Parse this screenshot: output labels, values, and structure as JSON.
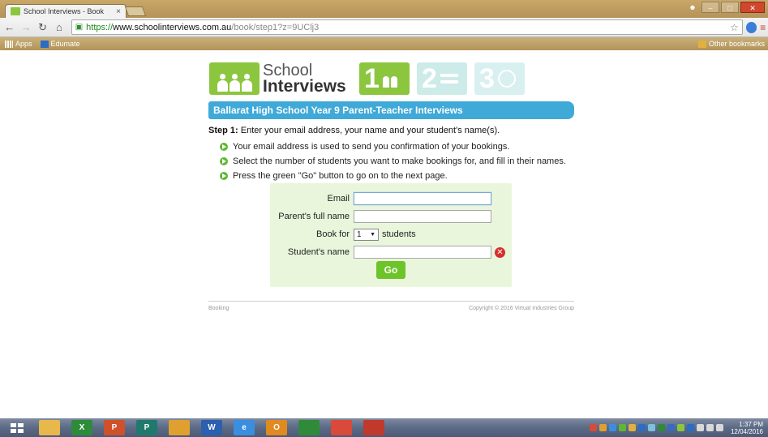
{
  "browser": {
    "tab_title": "School Interviews - Book",
    "tab_close": "×",
    "url_scheme": "https://",
    "url_host": "www.schoolinterviews.com.au",
    "url_path": "/book/step1?z=9UClj3",
    "bookmarks": [
      {
        "label": "Apps"
      },
      {
        "label": "Edumate"
      }
    ],
    "other_bookmarks": "Other bookmarks"
  },
  "logo": {
    "line1": "School",
    "line2": "Interviews"
  },
  "steps": [
    {
      "number": "1",
      "color": "#8cc63f"
    },
    {
      "number": "2",
      "color": "#cdebe8"
    },
    {
      "number": "3",
      "color": "#d9f0f0"
    }
  ],
  "page": {
    "title": "Ballarat High School Year 9 Parent-Teacher Interviews",
    "step_label": "Step 1:",
    "step_text": " Enter your email address, your name and your student's name(s).",
    "bullets": [
      "Your email address is used to send you confirmation of your bookings.",
      "Select the number of students you want to make bookings for, and fill in their names.",
      "Press the green \"Go\" button to go on to the next page."
    ]
  },
  "form": {
    "email_label": "Email",
    "email_value": "",
    "parent_label": "Parent's full name",
    "parent_value": "",
    "book_for_label": "Book for",
    "book_for_value": "1",
    "book_for_suffix": "students",
    "student_label": "Student's name",
    "student_value": "",
    "go_label": "Go"
  },
  "footer": {
    "left": "Booking",
    "right": "Copyright © 2016 Virtual Industries Group"
  },
  "taskbar": {
    "apps": [
      {
        "name": "file-explorer",
        "color": "#e8b84a",
        "glyph": ""
      },
      {
        "name": "excel",
        "color": "#2e8b3a",
        "glyph": "X"
      },
      {
        "name": "powerpoint",
        "color": "#d0502a",
        "glyph": "P"
      },
      {
        "name": "publisher",
        "color": "#1f7a6c",
        "glyph": "P"
      },
      {
        "name": "folder",
        "color": "#e0a030",
        "glyph": ""
      },
      {
        "name": "word",
        "color": "#2b5fb0",
        "glyph": "W"
      },
      {
        "name": "internet-explorer",
        "color": "#3a8ee0",
        "glyph": "e"
      },
      {
        "name": "outlook",
        "color": "#e08a20",
        "glyph": "O"
      },
      {
        "name": "green-app",
        "color": "#2f8a3a",
        "glyph": ""
      },
      {
        "name": "chrome",
        "color": "#d94a3a",
        "glyph": ""
      },
      {
        "name": "acrobat",
        "color": "#c0392b",
        "glyph": ""
      }
    ],
    "time": "1:37 PM",
    "date": "12/04/2016"
  },
  "colors": {
    "brand_green": "#8cc63f",
    "title_blue": "#3fa9d8",
    "form_bg": "#e9f6dc",
    "go_green": "#6cc428",
    "error_red": "#d72d2d"
  }
}
